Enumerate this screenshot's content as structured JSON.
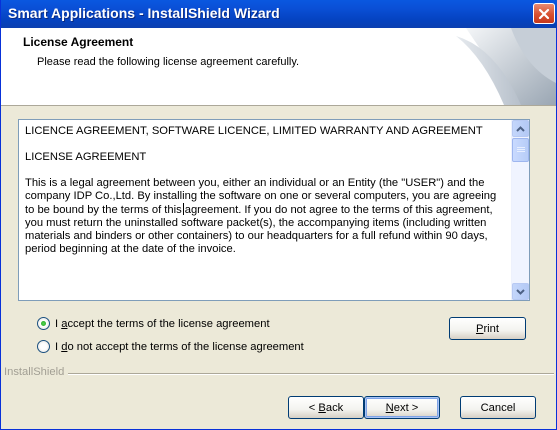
{
  "window": {
    "title": "Smart Applications - InstallShield Wizard"
  },
  "header": {
    "title": "License Agreement",
    "subtitle": "Please read the following license agreement carefully."
  },
  "license": {
    "heading": "LICENCE AGREEMENT, SOFTWARE LICENCE, LIMITED WARRANTY AND AGREEMENT",
    "subheading": "LICENSE AGREEMENT",
    "body_before_caret": "This is a legal agreement between you, either an individual or an Entity (the \"USER\") and the company IDP Co.,Ltd. By installing the software on one or several computers, you are agreeing to be bound by the terms of this",
    "body_after_caret": "agreement. If you do not agree to the terms of this agreement, you must return the uninstalled software packet(s), the accompanying items (including written materials and binders or other containers) to our headquarters for a full refund within 90 days, period beginning at the date of the invoice."
  },
  "options": {
    "accept": {
      "prefix": "",
      "accesskey": "a",
      "rest": "ccept the terms of the license agreement",
      "lead": "I ",
      "selected": true
    },
    "decline": {
      "lead": "I ",
      "accesskey": "d",
      "rest": "o not accept the terms of the license agreement",
      "selected": false
    }
  },
  "buttons": {
    "print": {
      "accesskey": "P",
      "rest": "rint"
    },
    "back": {
      "prefix": "< ",
      "accesskey": "B",
      "rest": "ack"
    },
    "next": {
      "accesskey": "N",
      "rest": "ext >"
    },
    "cancel": "Cancel"
  },
  "footer": {
    "brand": "InstallShield"
  },
  "colors": {
    "titlebar": "#0a4fd6",
    "close_button": "#d7502f",
    "dialog_bg": "#ece9d8",
    "field_border": "#7f9db9"
  },
  "icons": {
    "close": "close-icon",
    "scroll_up": "arrow-up-icon",
    "scroll_down": "arrow-down-icon"
  }
}
